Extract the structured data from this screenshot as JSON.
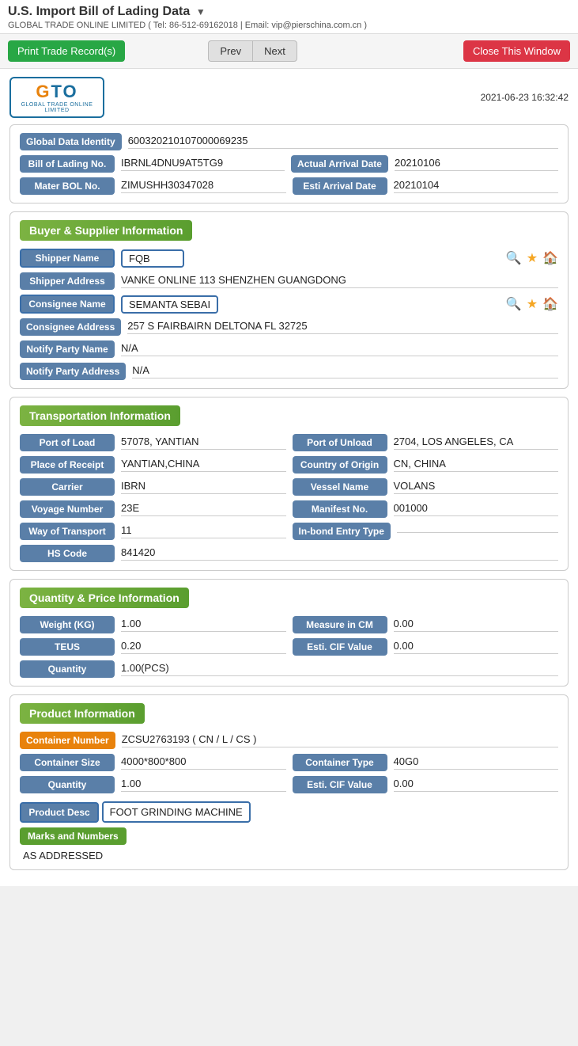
{
  "header": {
    "title": "U.S. Import Bill of Lading Data",
    "subtitle": "GLOBAL TRADE ONLINE LIMITED ( Tel: 86-512-69162018 | Email: vip@pierschina.com.cn )",
    "timestamp": "2021-06-23 16:32:42"
  },
  "toolbar": {
    "print_label": "Print Trade Record(s)",
    "prev_label": "Prev",
    "next_label": "Next",
    "close_label": "Close This Window"
  },
  "logo": {
    "text": "GTO",
    "subtext": "GLOBAL TRADE ONLINE LIMITED"
  },
  "identity": {
    "global_data_identity_label": "Global Data Identity",
    "global_data_identity_value": "600320210107000069235",
    "bol_no_label": "Bill of Lading No.",
    "bol_no_value": "IBRNL4DNU9AT5TG9",
    "actual_arrival_label": "Actual Arrival Date",
    "actual_arrival_value": "20210106",
    "mater_bol_label": "Mater BOL No.",
    "mater_bol_value": "ZIMUSHH30347028",
    "esti_arrival_label": "Esti Arrival Date",
    "esti_arrival_value": "20210104"
  },
  "buyer_supplier": {
    "section_title": "Buyer & Supplier Information",
    "shipper_name_label": "Shipper Name",
    "shipper_name_value": "FQB",
    "shipper_address_label": "Shipper Address",
    "shipper_address_value": "VANKE ONLINE 113 SHENZHEN GUANGDONG",
    "consignee_name_label": "Consignee Name",
    "consignee_name_value": "SEMANTA SEBAI",
    "consignee_address_label": "Consignee Address",
    "consignee_address_value": "257 S FAIRBAIRN DELTONA FL 32725",
    "notify_party_name_label": "Notify Party Name",
    "notify_party_name_value": "N/A",
    "notify_party_address_label": "Notify Party Address",
    "notify_party_address_value": "N/A"
  },
  "transportation": {
    "section_title": "Transportation Information",
    "port_of_load_label": "Port of Load",
    "port_of_load_value": "57078, YANTIAN",
    "port_of_unload_label": "Port of Unload",
    "port_of_unload_value": "2704, LOS ANGELES, CA",
    "place_of_receipt_label": "Place of Receipt",
    "place_of_receipt_value": "YANTIAN,CHINA",
    "country_of_origin_label": "Country of Origin",
    "country_of_origin_value": "CN, CHINA",
    "carrier_label": "Carrier",
    "carrier_value": "IBRN",
    "vessel_name_label": "Vessel Name",
    "vessel_name_value": "VOLANS",
    "voyage_number_label": "Voyage Number",
    "voyage_number_value": "23E",
    "manifest_no_label": "Manifest No.",
    "manifest_no_value": "001000",
    "way_of_transport_label": "Way of Transport",
    "way_of_transport_value": "11",
    "in_bond_entry_label": "In-bond Entry Type",
    "in_bond_entry_value": "",
    "hs_code_label": "HS Code",
    "hs_code_value": "841420"
  },
  "quantity_price": {
    "section_title": "Quantity & Price Information",
    "weight_label": "Weight (KG)",
    "weight_value": "1.00",
    "measure_label": "Measure in CM",
    "measure_value": "0.00",
    "teus_label": "TEUS",
    "teus_value": "0.20",
    "esti_cif_label": "Esti. CIF Value",
    "esti_cif_value": "0.00",
    "quantity_label": "Quantity",
    "quantity_value": "1.00(PCS)"
  },
  "product": {
    "section_title": "Product Information",
    "container_number_label": "Container Number",
    "container_number_value": "ZCSU2763193 ( CN / L / CS )",
    "container_size_label": "Container Size",
    "container_size_value": "4000*800*800",
    "container_type_label": "Container Type",
    "container_type_value": "40G0",
    "quantity_label": "Quantity",
    "quantity_value": "1.00",
    "esti_cif_label": "Esti. CIF Value",
    "esti_cif_value": "0.00",
    "product_desc_label": "Product Desc",
    "product_desc_value": "FOOT GRINDING MACHINE",
    "marks_label": "Marks and Numbers",
    "marks_value": "AS ADDRESSED"
  }
}
